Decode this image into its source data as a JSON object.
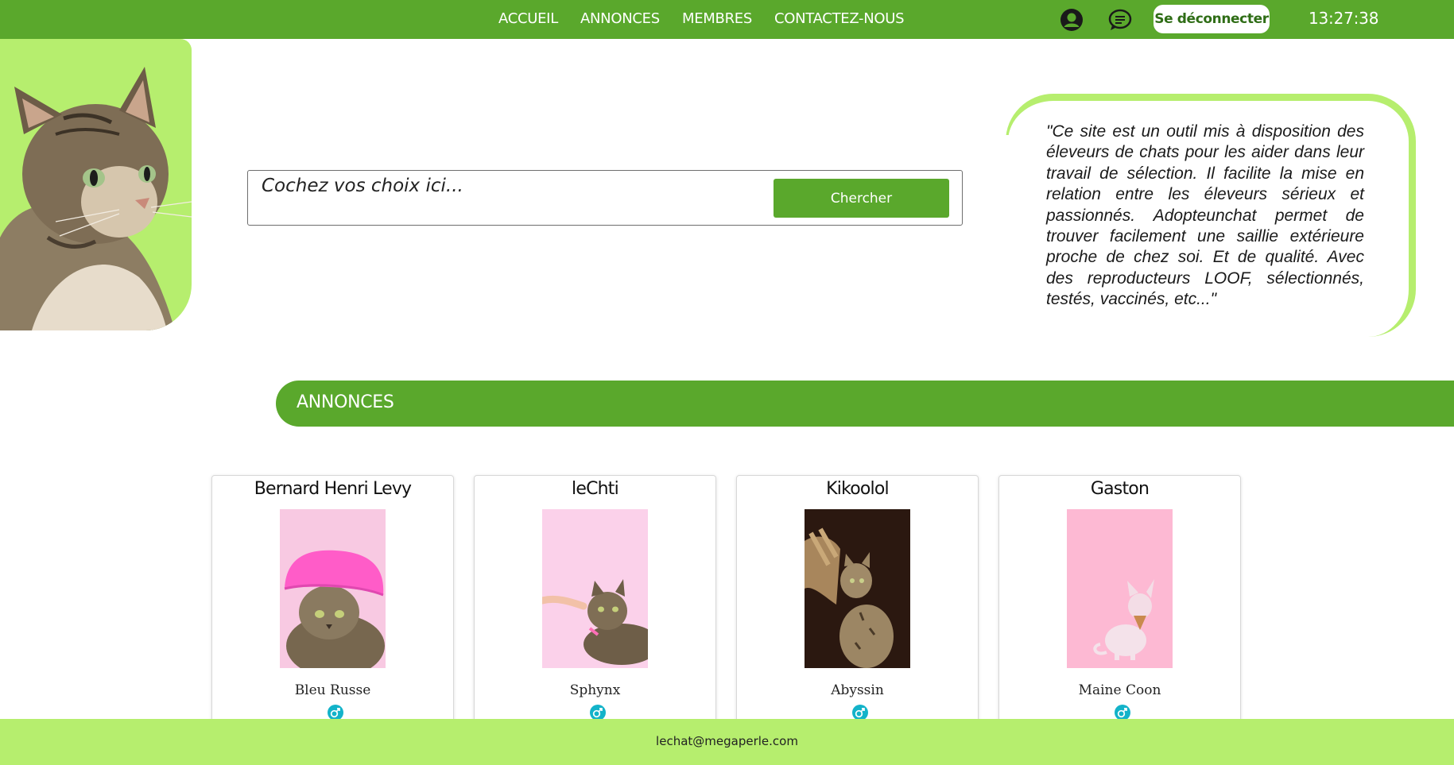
{
  "nav": {
    "links": [
      "ACCUEIL",
      "ANNONCES",
      "MEMBRES",
      "CONTACTEZ-NOUS"
    ],
    "logout_label": "Se déconnecter",
    "clock": "13:27:38",
    "icons": [
      "profile-icon",
      "messages-icon"
    ]
  },
  "search": {
    "placeholder": "Cochez vos choix ici...",
    "button_label": "Chercher"
  },
  "quote": {
    "text": "\"Ce site est un outil mis à disposition des éleveurs de chats pour les aider dans leur travail de sélection. Il facilite la mise en relation entre les éleveurs sérieux et passionnés. Adopteunchat permet de trouver facilement une saillie extérieure proche de chez soi. Et de qualité. Avec des reproducteurs LOOF, sélectionnés, testés, vaccinés, etc...\""
  },
  "section": {
    "title": "ANNONCES"
  },
  "cards": [
    {
      "name": "Bernard Henri Levy",
      "breed": "Bleu Russe",
      "gender": "male-icon"
    },
    {
      "name": "leChti",
      "breed": "Sphynx",
      "gender": "male-icon"
    },
    {
      "name": "Kikoolol",
      "breed": "Abyssin",
      "gender": "male-icon"
    },
    {
      "name": "Gaston",
      "breed": "Maine Coon",
      "gender": "male-icon"
    }
  ],
  "footer": {
    "email": "lechat@megaperle.com"
  },
  "colors": {
    "primary_green": "#5aa82c",
    "light_green": "#b6ee6e",
    "gender_badge": "#13b3c9"
  }
}
